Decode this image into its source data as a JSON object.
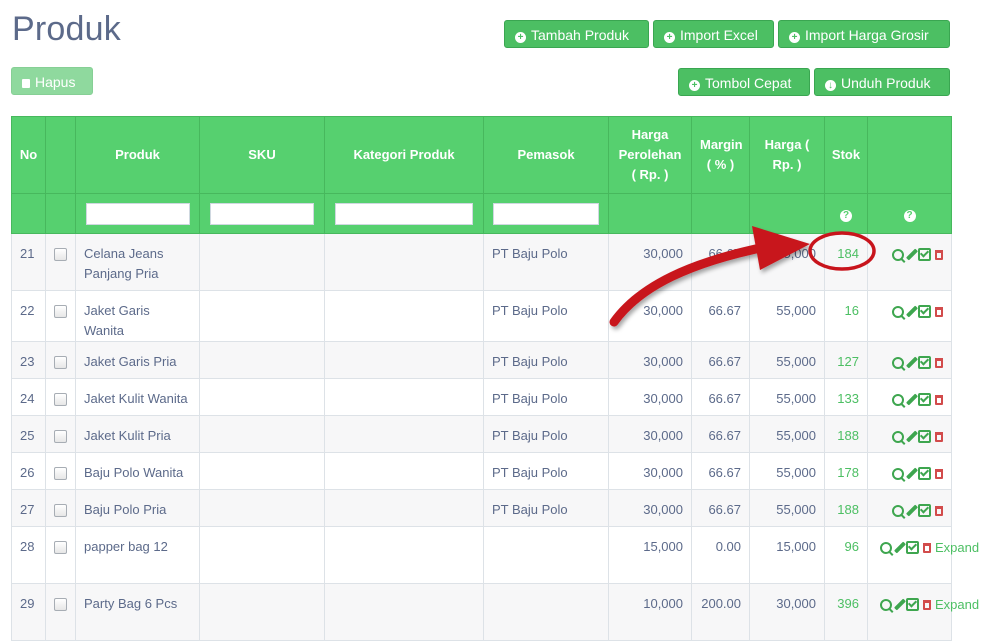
{
  "page": {
    "title": "Produk"
  },
  "toolbar": {
    "tambah_produk": "Tambah Produk",
    "import_excel": "Import Excel",
    "import_harga_grosir": "Import Harga Grosir",
    "hapus": "Hapus",
    "tombol_cepat": "Tombol Cepat",
    "unduh_produk": "Unduh Produk"
  },
  "table": {
    "headers": {
      "no": "No",
      "produk": "Produk",
      "sku": "SKU",
      "kategori": "Kategori Produk",
      "pemasok": "Pemasok",
      "harga_perolehan": "Harga Perolehan ( Rp. )",
      "margin": "Margin ( % )",
      "harga": "Harga ( Rp. )",
      "stok": "Stok"
    },
    "help_glyph": "?",
    "expand_label": "Expand",
    "rows": [
      {
        "no": "21",
        "produk": "Celana Jeans Panjang Pria",
        "sku": "",
        "kategori": "",
        "pemasok": "PT Baju Polo",
        "harga_perolehan": "30,000",
        "margin": "66.67",
        "harga": "55,000",
        "stok": "184"
      },
      {
        "no": "22",
        "produk": "Jaket Garis Wanita",
        "sku": "",
        "kategori": "",
        "pemasok": "PT Baju Polo",
        "harga_perolehan": "30,000",
        "margin": "66.67",
        "harga": "55,000",
        "stok": "16"
      },
      {
        "no": "23",
        "produk": "Jaket Garis Pria",
        "sku": "",
        "kategori": "",
        "pemasok": "PT Baju Polo",
        "harga_perolehan": "30,000",
        "margin": "66.67",
        "harga": "55,000",
        "stok": "127"
      },
      {
        "no": "24",
        "produk": "Jaket Kulit Wanita",
        "sku": "",
        "kategori": "",
        "pemasok": "PT Baju Polo",
        "harga_perolehan": "30,000",
        "margin": "66.67",
        "harga": "55,000",
        "stok": "133"
      },
      {
        "no": "25",
        "produk": "Jaket Kulit Pria",
        "sku": "",
        "kategori": "",
        "pemasok": "PT Baju Polo",
        "harga_perolehan": "30,000",
        "margin": "66.67",
        "harga": "55,000",
        "stok": "188"
      },
      {
        "no": "26",
        "produk": "Baju Polo Wanita",
        "sku": "",
        "kategori": "",
        "pemasok": "PT Baju Polo",
        "harga_perolehan": "30,000",
        "margin": "66.67",
        "harga": "55,000",
        "stok": "178"
      },
      {
        "no": "27",
        "produk": "Baju Polo Pria",
        "sku": "",
        "kategori": "",
        "pemasok": "PT Baju Polo",
        "harga_perolehan": "30,000",
        "margin": "66.67",
        "harga": "55,000",
        "stok": "188"
      },
      {
        "no": "28",
        "produk": "papper bag 12",
        "sku": "",
        "kategori": "",
        "pemasok": "",
        "harga_perolehan": "15,000",
        "margin": "0.00",
        "harga": "15,000",
        "stok": "96"
      },
      {
        "no": "29",
        "produk": "Party Bag 6 Pcs",
        "sku": "",
        "kategori": "",
        "pemasok": "",
        "harga_perolehan": "10,000",
        "margin": "200.00",
        "harga": "30,000",
        "stok": "396"
      }
    ]
  },
  "colors": {
    "header_green": "#56d06f",
    "button_green": "#4cbf63",
    "title": "#5c6a8a",
    "annotation_red": "#c8141c"
  }
}
